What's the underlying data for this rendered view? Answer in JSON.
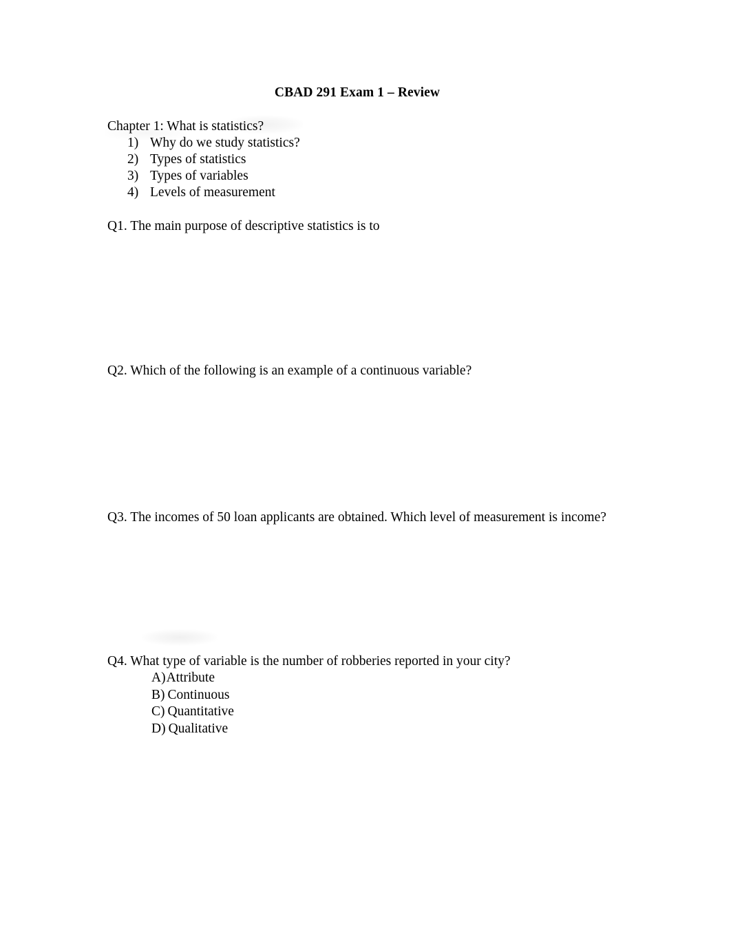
{
  "document": {
    "title": "CBAD 291 Exam 1 – Review",
    "page_background": "#ffffff",
    "text_color": "#000000"
  },
  "chapter": {
    "heading": "Chapter 1: What is statistics?",
    "topics": [
      {
        "number": "1)",
        "text": "Why do we study statistics?"
      },
      {
        "number": "2)",
        "text": "Types of statistics"
      },
      {
        "number": "3)",
        "text": "Types of variables"
      },
      {
        "number": "4)",
        "text": "Levels of measurement"
      }
    ]
  },
  "questions": [
    {
      "id": "q1",
      "text": "Q1. The main purpose of descriptive statistics is to",
      "options": []
    },
    {
      "id": "q2",
      "text": "Q2. Which of the following is an example of a continuous variable?",
      "options": []
    },
    {
      "id": "q3",
      "text": "Q3. The incomes of 50 loan applicants are obtained. Which level of measurement is income?",
      "options": []
    },
    {
      "id": "q4",
      "text": "Q4. What type of variable is the number of robberies reported in your city?",
      "options": [
        {
          "label": "A)",
          "text": "Attribute"
        },
        {
          "label": "B)",
          "text": "Continuous"
        },
        {
          "label": "C)",
          "text": "Quantitative"
        },
        {
          "label": "D)",
          "text": "Qualitative"
        }
      ]
    }
  ]
}
